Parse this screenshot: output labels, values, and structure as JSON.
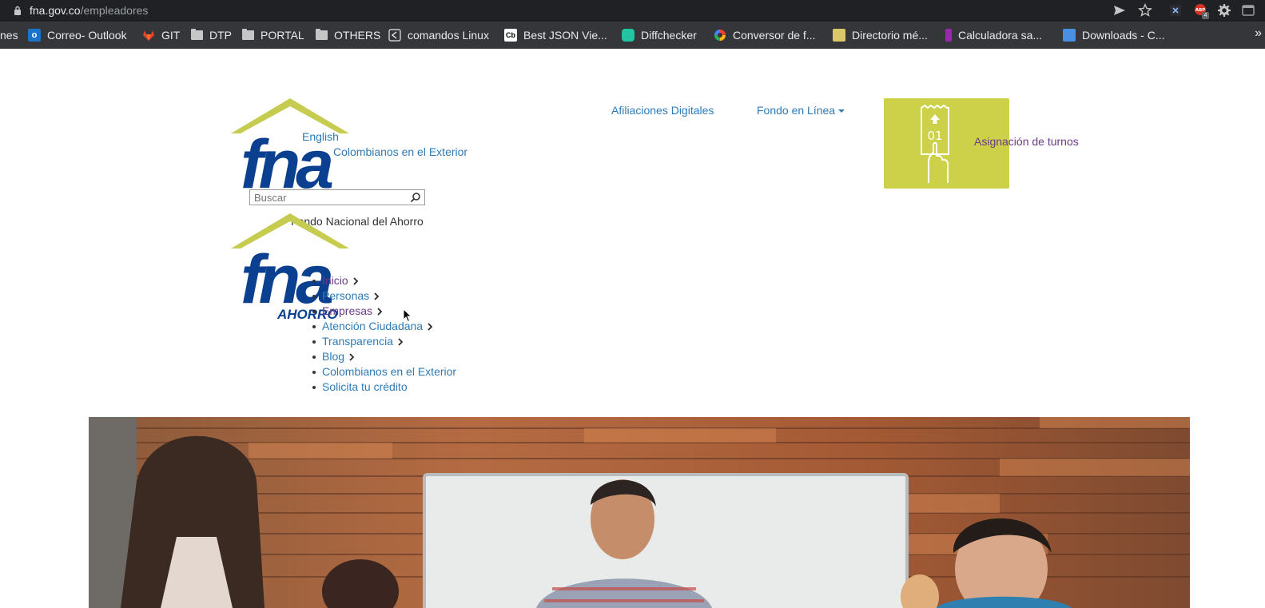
{
  "browser": {
    "url": {
      "host": "fna.gov.co",
      "path": "/empleadores"
    },
    "icons": [
      "lock-icon",
      "send-icon",
      "star-icon",
      "extension-x-icon",
      "adblock-icon",
      "gear-icon",
      "window-icon"
    ],
    "adblock_count": "4",
    "bookmarks": [
      {
        "label": "nes",
        "icon": "cut-off-bookmark"
      },
      {
        "label": "Correo- Outlook",
        "icon": "outlook-icon",
        "color": "#1a73c9"
      },
      {
        "label": "GIT",
        "icon": "gitlab-icon",
        "color": "#e2432a"
      },
      {
        "label": "DTP",
        "icon": "folder-icon"
      },
      {
        "label": "PORTAL",
        "icon": "folder-icon"
      },
      {
        "label": "OTHERS",
        "icon": "folder-icon"
      },
      {
        "label": "comandos Linux",
        "icon": "share-icon"
      },
      {
        "label": "Best JSON Vie...",
        "icon": "cb-icon"
      },
      {
        "label": "Diffchecker",
        "icon": "diffchecker-icon",
        "color": "#22c3a0"
      },
      {
        "label": "Conversor de f...",
        "icon": "color-wheel-icon"
      },
      {
        "label": "Directorio mé...",
        "icon": "directory-icon",
        "color": "#d9c76a"
      },
      {
        "label": "Calculadora sa...",
        "icon": "calculator-icon",
        "color": "#9c27b0"
      },
      {
        "label": "Downloads - C...",
        "icon": "downloads-icon",
        "color": "#4a90e2"
      }
    ],
    "more_symbol": "»"
  },
  "header": {
    "logo": {
      "text": "fna",
      "subtext": "AHORRO",
      "brand_color": "#0b3f8f",
      "roof_color": "#c6cc50"
    },
    "english_link": "English",
    "colombianos_link": "Colombianos en el Exterior",
    "search": {
      "placeholder": "Buscar"
    },
    "tagline": "Fondo Nacional del Ahorro",
    "top_nav": {
      "afiliaciones": "Afiliaciones Digitales",
      "fondo": "Fondo en Línea"
    },
    "turnos": {
      "ticket_number": "01",
      "label": "Asignación de turnos",
      "box_color": "#cdd14a"
    }
  },
  "menu": {
    "items": [
      {
        "label": "Inicio",
        "chevron": true,
        "visited": true
      },
      {
        "label": "Personas",
        "chevron": true,
        "visited": false
      },
      {
        "label": "Empresas",
        "chevron": true,
        "visited": true
      },
      {
        "label": "Atención Ciudadana",
        "chevron": true,
        "visited": false
      },
      {
        "label": "Transparencia",
        "chevron": true,
        "visited": false
      },
      {
        "label": "Blog",
        "chevron": true,
        "visited": false
      },
      {
        "label": "Colombianos en el Exterior",
        "chevron": false,
        "visited": false
      },
      {
        "label": "Solicita tu crédito",
        "chevron": false,
        "visited": false
      }
    ]
  },
  "colors": {
    "link": "#2e7bb8",
    "visited": "#6b3a8a",
    "chrome_bg": "#202124",
    "bookmarks_bg": "#35363a"
  }
}
